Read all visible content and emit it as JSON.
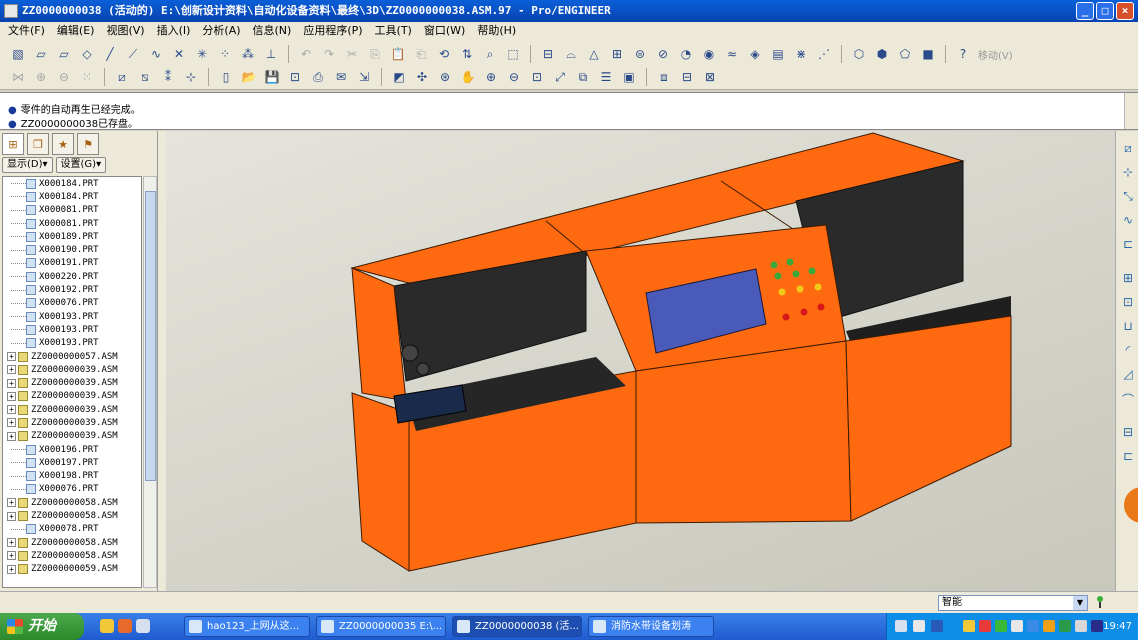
{
  "window": {
    "title": "ZZ0000000038 (活动的) E:\\创新设计资料\\自动化设备资料\\最终\\3D\\ZZ0000000038.ASM.97 - Pro/ENGINEER",
    "controls": [
      "_",
      "□",
      "×"
    ]
  },
  "menu": [
    "文件(F)",
    "编辑(E)",
    "视图(V)",
    "插入(I)",
    "分析(A)",
    "信息(N)",
    "应用程序(P)",
    "工具(T)",
    "窗口(W)",
    "帮助(H)"
  ],
  "toolbar": {
    "move_label": "移动(V)"
  },
  "messages": [
    "零件的自动再生已经完成。",
    "ZZ0000000038已存盘。"
  ],
  "panel": {
    "show_button": "显示(D)▾",
    "settings_button": "设置(G)▾"
  },
  "tree": [
    {
      "name": "X000184.PRT",
      "type": "prt"
    },
    {
      "name": "X000184.PRT",
      "type": "prt"
    },
    {
      "name": "X000081.PRT",
      "type": "prt"
    },
    {
      "name": "X000081.PRT",
      "type": "prt"
    },
    {
      "name": "X000189.PRT",
      "type": "prt"
    },
    {
      "name": "X000190.PRT",
      "type": "prt"
    },
    {
      "name": "X000191.PRT",
      "type": "prt"
    },
    {
      "name": "X000220.PRT",
      "type": "prt"
    },
    {
      "name": "X000192.PRT",
      "type": "prt"
    },
    {
      "name": "X000076.PRT",
      "type": "prt"
    },
    {
      "name": "X000193.PRT",
      "type": "prt"
    },
    {
      "name": "X000193.PRT",
      "type": "prt"
    },
    {
      "name": "X000193.PRT",
      "type": "prt"
    },
    {
      "name": "ZZ0000000057.ASM",
      "type": "asm"
    },
    {
      "name": "ZZ0000000039.ASM",
      "type": "asm"
    },
    {
      "name": "ZZ0000000039.ASM",
      "type": "asm"
    },
    {
      "name": "ZZ0000000039.ASM",
      "type": "asm"
    },
    {
      "name": "ZZ0000000039.ASM",
      "type": "asm"
    },
    {
      "name": "ZZ0000000039.ASM",
      "type": "asm"
    },
    {
      "name": "ZZ0000000039.ASM",
      "type": "asm"
    },
    {
      "name": "X000196.PRT",
      "type": "prt"
    },
    {
      "name": "X000197.PRT",
      "type": "prt"
    },
    {
      "name": "X000198.PRT",
      "type": "prt"
    },
    {
      "name": "X000076.PRT",
      "type": "prt"
    },
    {
      "name": "ZZ0000000058.ASM",
      "type": "asm"
    },
    {
      "name": "ZZ0000000058.ASM",
      "type": "asm"
    },
    {
      "name": "X000078.PRT",
      "type": "prt"
    },
    {
      "name": "ZZ0000000058.ASM",
      "type": "asm"
    },
    {
      "name": "ZZ0000000058.ASM",
      "type": "asm"
    },
    {
      "name": "ZZ0000000059.ASM",
      "type": "asm"
    }
  ],
  "status": {
    "filter_value": "智能"
  },
  "taskbar": {
    "start_label": "开始",
    "tasks": [
      {
        "label": "hao123_上网从这..."
      },
      {
        "label": "ZZ0000000035 E:\\..."
      },
      {
        "label": "ZZ0000000038 (活..."
      },
      {
        "label": "消防水带设备划涛"
      }
    ],
    "clock": "19:47"
  },
  "colors": {
    "machine_orange": "#ff6600",
    "machine_dark": "#2a2a2a",
    "screen_blue": "#4a5ab8"
  }
}
